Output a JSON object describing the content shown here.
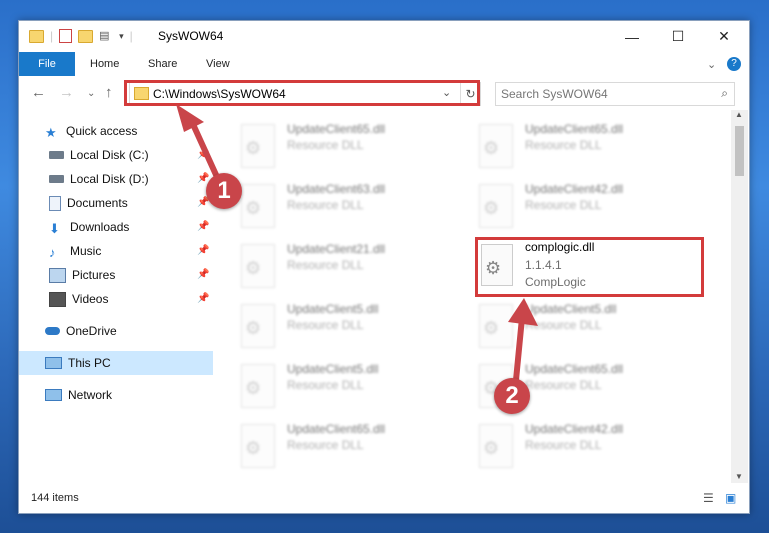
{
  "window": {
    "title": "SysWOW64"
  },
  "ribbon": {
    "tabs": [
      "File",
      "Home",
      "Share",
      "View"
    ]
  },
  "address": {
    "path": "C:\\Windows\\SysWOW64"
  },
  "search": {
    "placeholder": "Search SysWOW64"
  },
  "sidebar": {
    "items": [
      {
        "label": "Quick access",
        "icon": "star-icon"
      },
      {
        "label": "Local Disk (C:)",
        "icon": "drive-icon",
        "pinned": true
      },
      {
        "label": "Local Disk (D:)",
        "icon": "drive-icon",
        "pinned": true
      },
      {
        "label": "Documents",
        "icon": "documents-icon",
        "pinned": true
      },
      {
        "label": "Downloads",
        "icon": "downloads-icon",
        "pinned": true
      },
      {
        "label": "Music",
        "icon": "music-icon",
        "pinned": true
      },
      {
        "label": "Pictures",
        "icon": "pictures-icon",
        "pinned": true
      },
      {
        "label": "Videos",
        "icon": "videos-icon",
        "pinned": true
      },
      {
        "label": "OneDrive",
        "icon": "cloud-icon"
      },
      {
        "label": "This PC",
        "icon": "computer-icon",
        "selected": true
      },
      {
        "label": "Network",
        "icon": "network-icon"
      }
    ]
  },
  "files": {
    "left": [
      {
        "name": "UpdateClient65.dll",
        "type": "Resource DLL"
      },
      {
        "name": "UpdateClient63.dll",
        "type": "Resource DLL"
      },
      {
        "name": "UpdateClient21.dll",
        "type": "Resource DLL"
      },
      {
        "name": "UpdateClient5.dll",
        "type": "Resource DLL"
      },
      {
        "name": "UpdateClient5.dll",
        "type": "Resource DLL"
      },
      {
        "name": "UpdateClient65.dll",
        "type": "Resource DLL"
      }
    ],
    "right_top": [
      {
        "name": "UpdateClient65.dll",
        "type": "Resource DLL"
      },
      {
        "name": "UpdateClient42.dll",
        "type": "Resource DLL"
      }
    ],
    "highlight": {
      "name": "complogic.dll",
      "version": "1.1.4.1",
      "company": "CompLogic"
    },
    "right_bottom": [
      {
        "name": "UpdateClient5.dll",
        "type": "Resource DLL"
      },
      {
        "name": "UpdateClient65.dll",
        "type": "Resource DLL"
      },
      {
        "name": "UpdateClient42.dll",
        "type": "Resource DLL"
      }
    ]
  },
  "status": {
    "items_count": "144 items"
  },
  "annotations": {
    "step1": "1",
    "step2": "2",
    "accent": "#d33b3b"
  }
}
